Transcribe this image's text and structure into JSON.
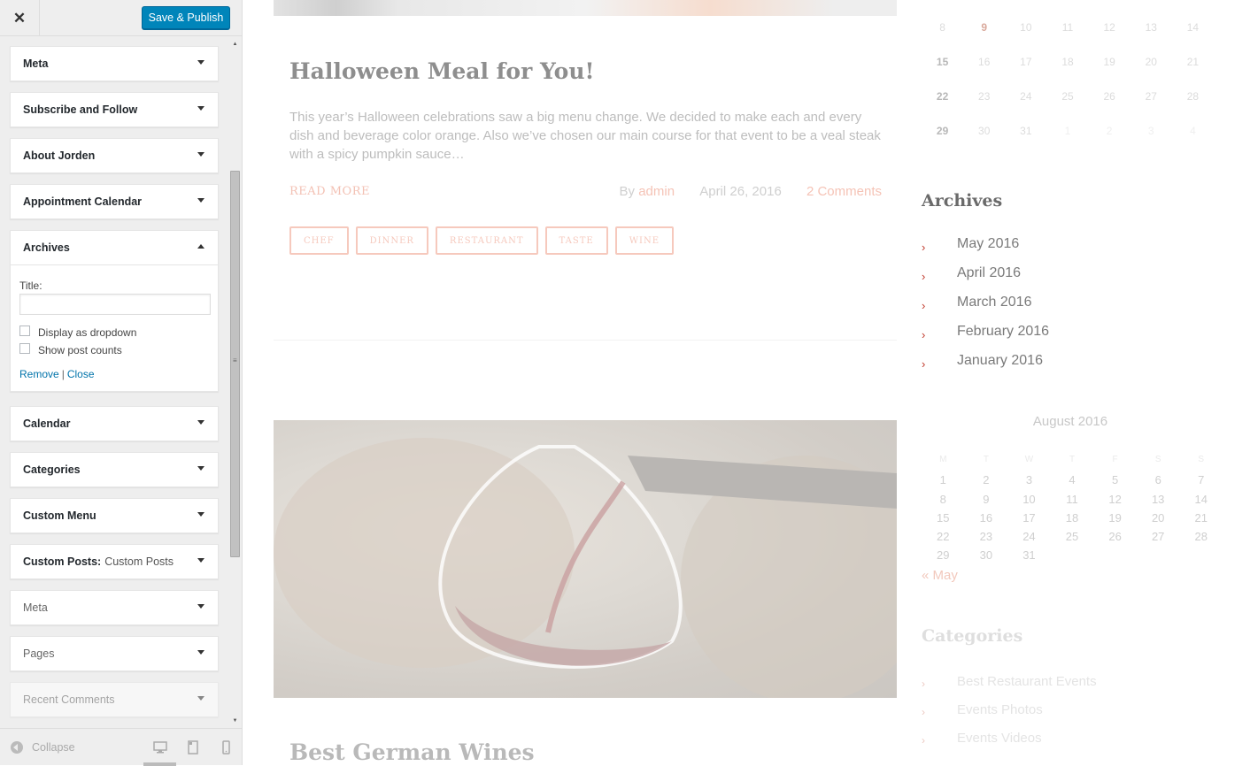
{
  "sidebar": {
    "close_icon": "close-icon",
    "publish_label": "Save & Publish",
    "widgets": {
      "meta": "Meta",
      "subscribe": "Subscribe and Follow",
      "about": "About Jorden",
      "appointment": "Appointment Calendar",
      "archives": "Archives",
      "calendar": "Calendar",
      "categories": "Categories",
      "custom_menu": "Custom Menu",
      "custom_posts": "Custom Posts:",
      "custom_posts_sub": "Custom Posts",
      "meta2": "Meta",
      "pages": "Pages",
      "recent_comments": "Recent Comments"
    },
    "archives_form": {
      "title_label": "Title:",
      "title_value": "",
      "dropdown_label": "Display as dropdown",
      "post_counts_label": "Show post counts",
      "remove_label": "Remove",
      "separator": "|",
      "close_label": "Close"
    },
    "footer": {
      "collapse_label": "Collapse"
    }
  },
  "preview": {
    "post": {
      "title": "Halloween Meal for You!",
      "excerpt": "This year’s Halloween celebrations saw a big menu change. We decided to make each and every dish and beverage color orange. Also we’ve chosen our main course for that event to be a veal steak with a spicy pumpkin sauce…",
      "read_more": "READ MORE",
      "by": "By",
      "author": "admin",
      "date": "April 26, 2016",
      "comments": "2 Comments",
      "tags": [
        "CHEF",
        "DINNER",
        "RESTAURANT",
        "TASTE",
        "WINE"
      ]
    },
    "post2_title": "Best German Wines",
    "top_calendar": {
      "rows": [
        [
          "8",
          "9",
          "10",
          "11",
          "12",
          "13",
          "14"
        ],
        [
          "15",
          "16",
          "17",
          "18",
          "19",
          "20",
          "21"
        ],
        [
          "22",
          "23",
          "24",
          "25",
          "26",
          "27",
          "28"
        ],
        [
          "29",
          "30",
          "31",
          "1",
          "2",
          "3",
          "4"
        ]
      ]
    },
    "archives": {
      "title": "Archives",
      "items": [
        "May 2016",
        "April 2016",
        "March 2016",
        "February 2016",
        "January 2016"
      ]
    },
    "aug_calendar": {
      "title": "August 2016",
      "headers": [
        "M",
        "T",
        "W",
        "T",
        "F",
        "S",
        "S"
      ],
      "rows": [
        [
          "1",
          "2",
          "3",
          "4",
          "5",
          "6",
          "7"
        ],
        [
          "8",
          "9",
          "10",
          "11",
          "12",
          "13",
          "14"
        ],
        [
          "15",
          "16",
          "17",
          "18",
          "19",
          "20",
          "21"
        ],
        [
          "22",
          "23",
          "24",
          "25",
          "26",
          "27",
          "28"
        ],
        [
          "29",
          "30",
          "31",
          "",
          "",
          "",
          ""
        ]
      ],
      "prev_link": "« May"
    },
    "categories": {
      "title": "Categories",
      "items": [
        "Best Restaurant Events",
        "Events Photos",
        "Events Videos"
      ]
    }
  },
  "colors": {
    "publish": "#0085ba",
    "link": "#0073aa",
    "accent": "#c0392b"
  }
}
